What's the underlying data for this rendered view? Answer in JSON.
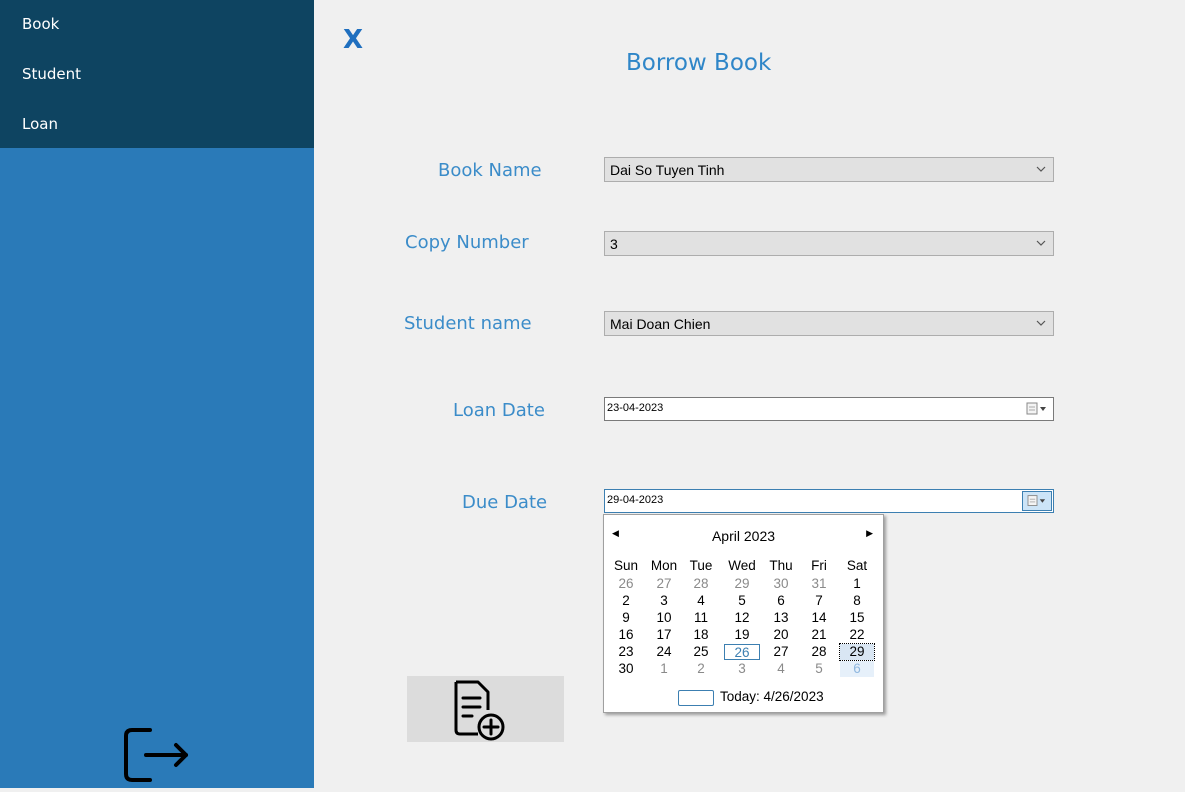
{
  "sidebar": {
    "menu": [
      {
        "label": "Book"
      },
      {
        "label": "Student"
      },
      {
        "label": "Loan"
      }
    ],
    "logout_icon": "logout-icon"
  },
  "form": {
    "close_label": "X",
    "title": "Borrow Book",
    "book_name": {
      "label": "Book Name",
      "value": "Dai So Tuyen Tinh"
    },
    "copy_number": {
      "label": "Copy Number",
      "value": "3"
    },
    "student_name": {
      "label": "Student name",
      "value": "Mai Doan Chien"
    },
    "loan_date": {
      "label": "Loan Date",
      "value": "23-04-2023"
    },
    "due_date": {
      "label": "Due Date",
      "value": "29-04-2023"
    },
    "add_button_icon": "document-add-icon"
  },
  "calendar": {
    "month": "April 2023",
    "prev_icon": "◀",
    "next_icon": "▶",
    "weekdays": [
      "Sun",
      "Mon",
      "Tue",
      "Wed",
      "Thu",
      "Fri",
      "Sat"
    ],
    "weeks": [
      [
        "26",
        "27",
        "28",
        "29",
        "30",
        "31",
        "1"
      ],
      [
        "2",
        "3",
        "4",
        "5",
        "6",
        "7",
        "8"
      ],
      [
        "9",
        "10",
        "11",
        "12",
        "13",
        "14",
        "15"
      ],
      [
        "16",
        "17",
        "18",
        "19",
        "20",
        "21",
        "22"
      ],
      [
        "23",
        "24",
        "25",
        "26",
        "27",
        "28",
        "29"
      ],
      [
        "30",
        "1",
        "2",
        "3",
        "4",
        "5",
        "6"
      ]
    ],
    "today_label": "Today: 4/26/2023"
  },
  "colors": {
    "sidebar_menu_bg": "#0e4461",
    "sidebar_bg": "#2a7ab8",
    "accent": "#2f86c8"
  }
}
